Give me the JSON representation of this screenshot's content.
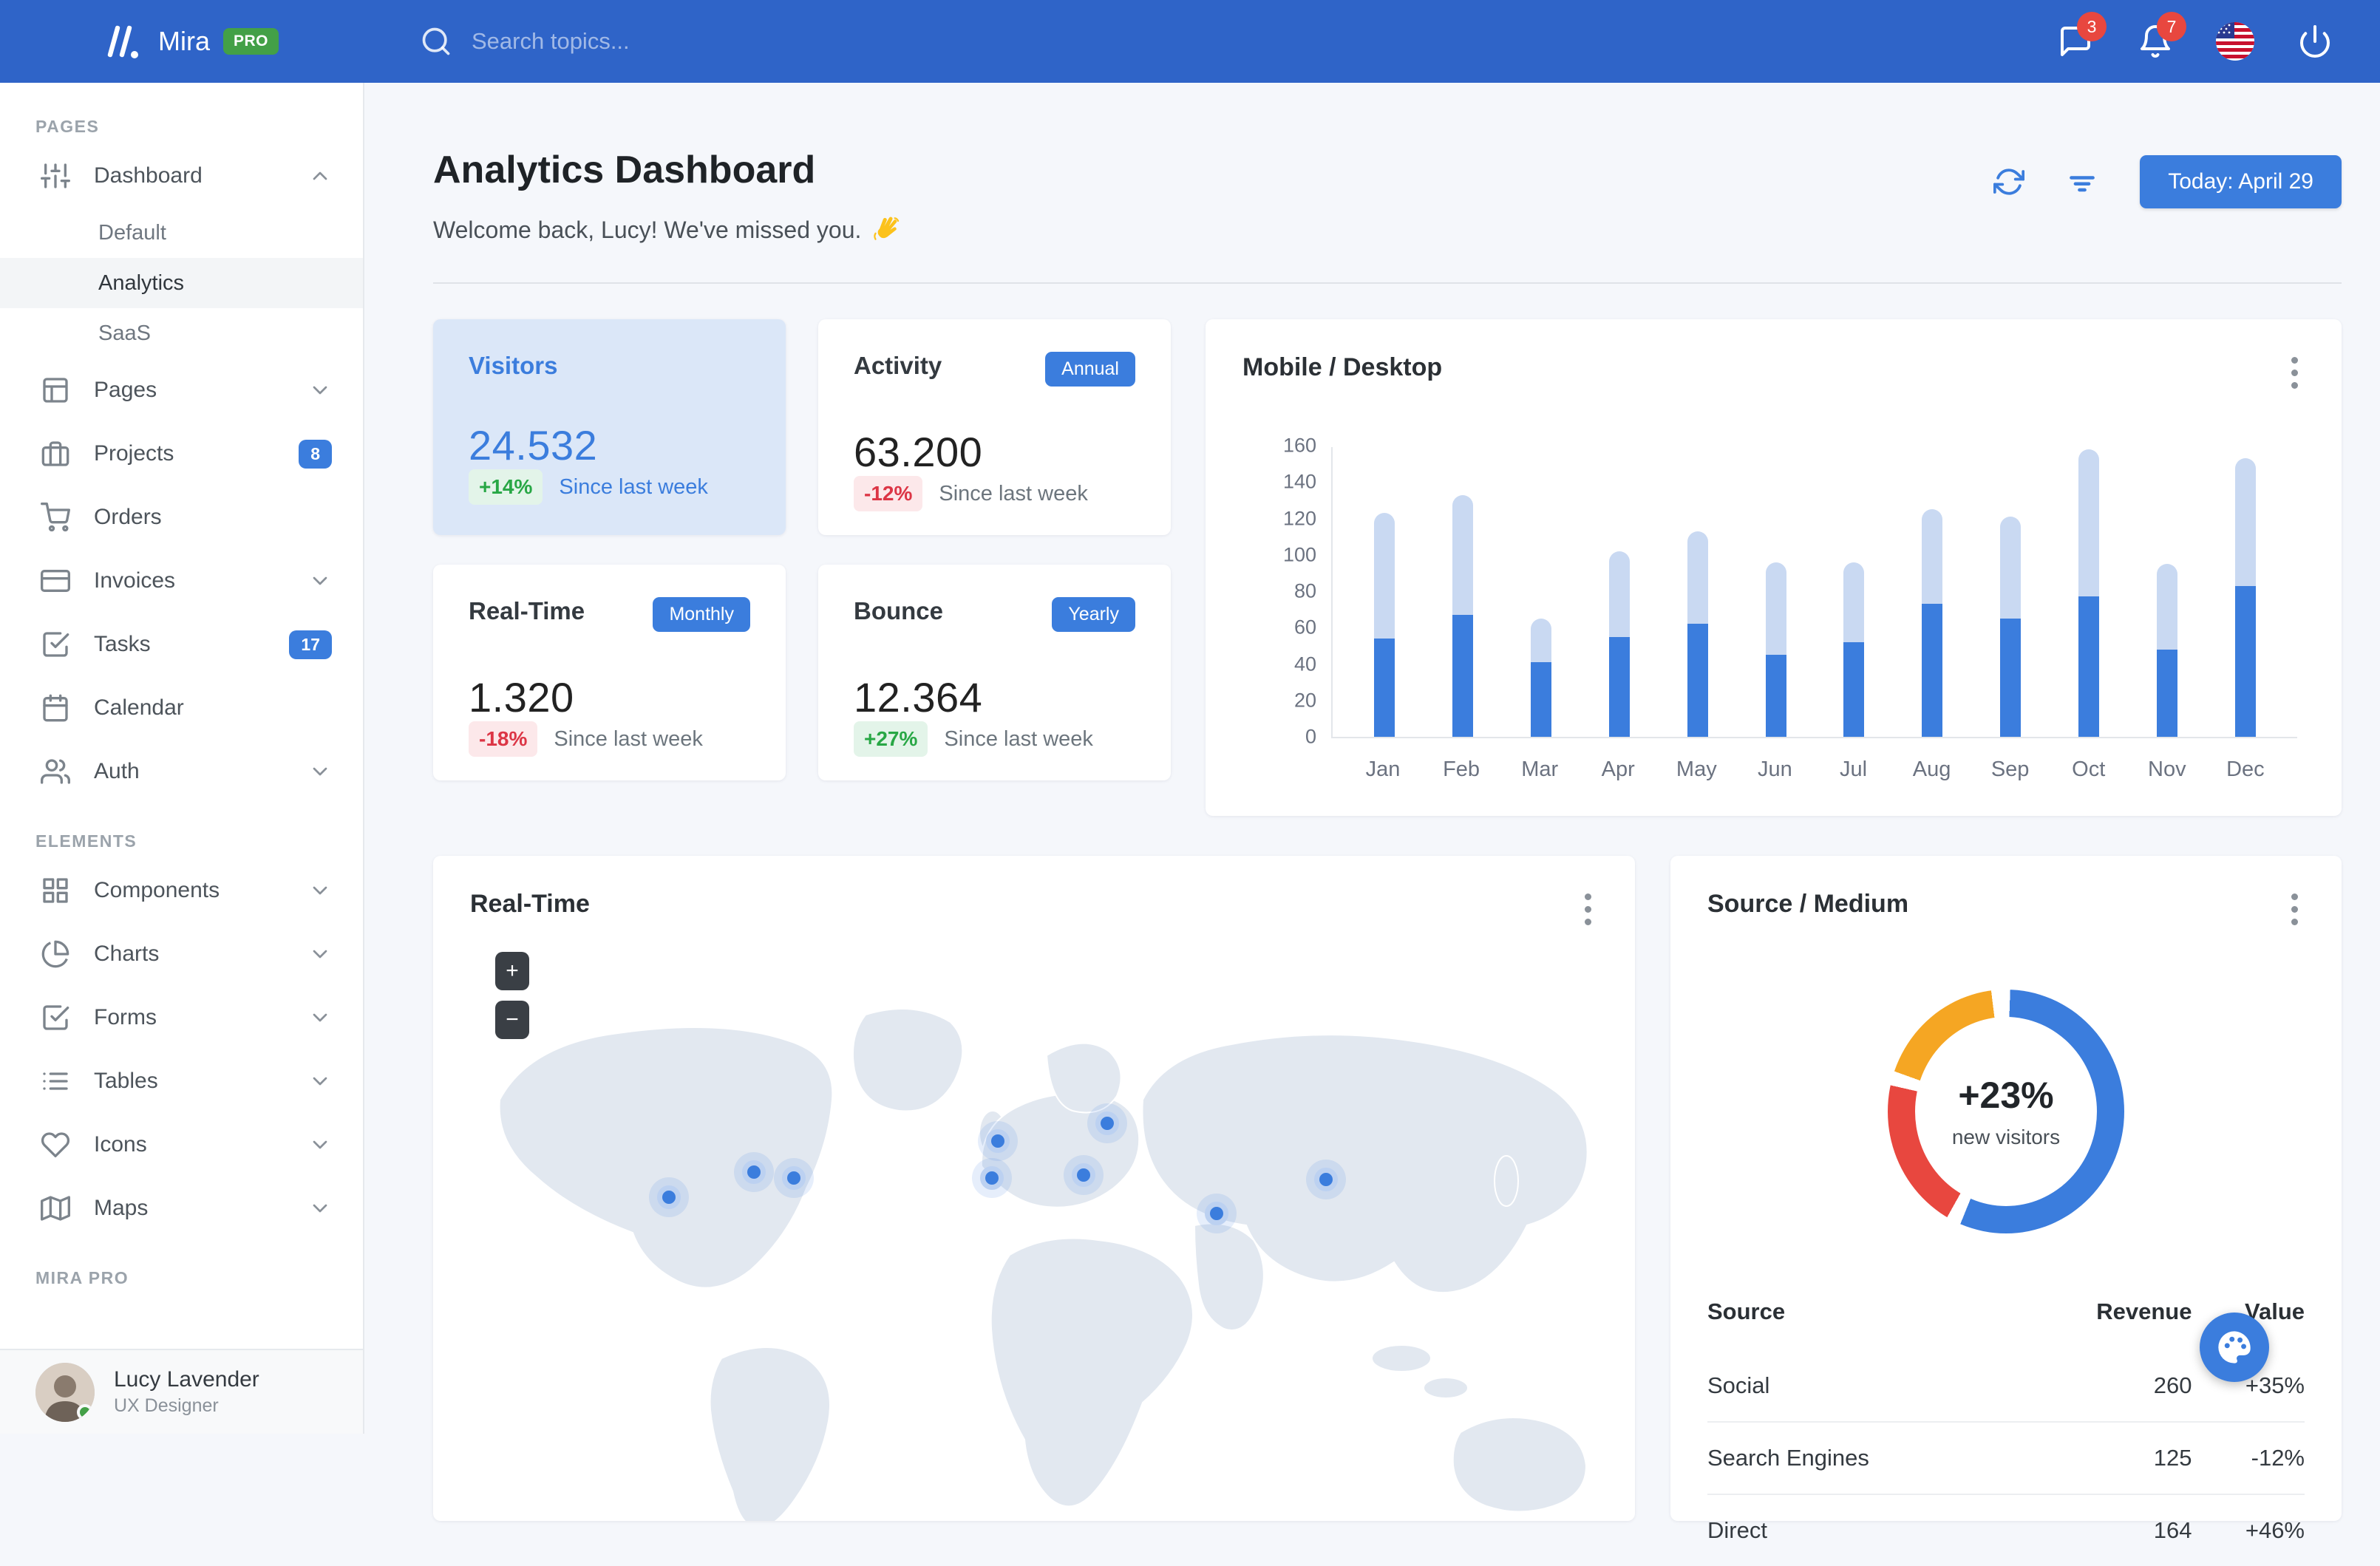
{
  "theme": {
    "accent": "#3B7DDD",
    "navbar_bg": "#2F64C8",
    "positive": "#28A745",
    "negative": "#DC3545",
    "light_bar": "#C9D9F2",
    "donut_red": "#E8473F",
    "donut_orange": "#F5A623",
    "page_bg": "#F5F7FB",
    "highlight_card_bg": "#DBE7F8"
  },
  "navbar": {
    "brand": "Mira",
    "pro_badge": "PRO",
    "search_placeholder": "Search topics...",
    "messages_badge": "3",
    "notifications_badge": "7"
  },
  "sidebar": {
    "sections": [
      {
        "label": "PAGES",
        "items": [
          {
            "label": "Dashboard",
            "icon": "sliders-icon",
            "chevron": "up",
            "children": [
              {
                "label": "Default",
                "active": false
              },
              {
                "label": "Analytics",
                "active": true
              },
              {
                "label": "SaaS",
                "active": false
              }
            ]
          },
          {
            "label": "Pages",
            "icon": "layout-icon",
            "chevron": "down"
          },
          {
            "label": "Projects",
            "icon": "briefcase-icon",
            "badge": "8"
          },
          {
            "label": "Orders",
            "icon": "shopping-cart-icon"
          },
          {
            "label": "Invoices",
            "icon": "credit-card-icon",
            "chevron": "down"
          },
          {
            "label": "Tasks",
            "icon": "check-square-icon",
            "badge": "17"
          },
          {
            "label": "Calendar",
            "icon": "calendar-icon"
          },
          {
            "label": "Auth",
            "icon": "users-icon",
            "chevron": "down"
          }
        ]
      },
      {
        "label": "ELEMENTS",
        "items": [
          {
            "label": "Components",
            "icon": "grid-icon",
            "chevron": "down"
          },
          {
            "label": "Charts",
            "icon": "pie-chart-icon",
            "chevron": "down"
          },
          {
            "label": "Forms",
            "icon": "form-check-icon",
            "chevron": "down"
          },
          {
            "label": "Tables",
            "icon": "list-icon",
            "chevron": "down"
          },
          {
            "label": "Icons",
            "icon": "heart-icon",
            "chevron": "down"
          },
          {
            "label": "Maps",
            "icon": "map-icon",
            "chevron": "down"
          }
        ]
      },
      {
        "label": "MIRA PRO",
        "items": []
      }
    ],
    "user": {
      "name": "Lucy Lavender",
      "role": "UX Designer"
    }
  },
  "header": {
    "title": "Analytics Dashboard",
    "subtitle": "Welcome back, Lucy! We've missed you.",
    "subtitle_emoji": "👋",
    "today_button": "Today: April 29"
  },
  "stats": [
    {
      "title": "Visitors",
      "value": "24.532",
      "badge": "",
      "delta": "+14%",
      "delta_type": "positive",
      "caption": "Since last week",
      "highlight": true
    },
    {
      "title": "Activity",
      "value": "63.200",
      "badge": "Annual",
      "delta": "-12%",
      "delta_type": "negative",
      "caption": "Since last week",
      "highlight": false
    },
    {
      "title": "Real-Time",
      "value": "1.320",
      "badge": "Monthly",
      "delta": "-18%",
      "delta_type": "negative",
      "caption": "Since last week",
      "highlight": false
    },
    {
      "title": "Bounce",
      "value": "12.364",
      "badge": "Yearly",
      "delta": "+27%",
      "delta_type": "positive",
      "caption": "Since last week",
      "highlight": false
    }
  ],
  "chart_data": [
    {
      "type": "bar",
      "stacked": true,
      "title": "Mobile / Desktop",
      "legend": "none",
      "grid": false,
      "categories": [
        "Jan",
        "Feb",
        "Mar",
        "Apr",
        "May",
        "Jun",
        "Jul",
        "Aug",
        "Sep",
        "Oct",
        "Nov",
        "Dec"
      ],
      "series": [
        {
          "name": "Mobile",
          "color": "#3B7DDD",
          "values": [
            54,
            67,
            41,
            55,
            62,
            45,
            52,
            73,
            65,
            77,
            48,
            83
          ]
        },
        {
          "name": "Desktop",
          "color": "#C9D9F2",
          "values": [
            69,
            66,
            24,
            47,
            51,
            51,
            44,
            52,
            56,
            81,
            47,
            70
          ]
        }
      ],
      "ylabel": "",
      "xlabel": "",
      "ylim": [
        0,
        160
      ],
      "yticks": [
        0,
        20,
        40,
        60,
        80,
        100,
        120,
        140,
        160
      ]
    },
    {
      "type": "pie",
      "donut": true,
      "title": "Source / Medium",
      "labels": [
        "segment-blue",
        "segment-red",
        "segment-orange"
      ],
      "values": [
        57,
        21,
        18
      ],
      "colors": [
        "#3B7DDD",
        "#E8473F",
        "#F5A623"
      ],
      "center_value": "+23%",
      "center_label": "new visitors",
      "legend": "none"
    }
  ],
  "realtime_map": {
    "title": "Real-Time",
    "zoom_in": "+",
    "zoom_out": "−",
    "markers": [
      {
        "x": 19.6,
        "y": 43.8
      },
      {
        "x": 26.7,
        "y": 39.5
      },
      {
        "x": 30.0,
        "y": 40.5
      },
      {
        "x": 47.0,
        "y": 34.1
      },
      {
        "x": 46.5,
        "y": 40.5
      },
      {
        "x": 56.1,
        "y": 31.0
      },
      {
        "x": 54.1,
        "y": 40.0
      },
      {
        "x": 65.2,
        "y": 46.7
      },
      {
        "x": 74.3,
        "y": 40.8
      }
    ]
  },
  "source_medium": {
    "title": "Source / Medium",
    "table": {
      "headers": [
        "Source",
        "Revenue",
        "Value"
      ],
      "rows": [
        {
          "source": "Social",
          "revenue": "260",
          "value": "+35%",
          "value_type": "positive"
        },
        {
          "source": "Search Engines",
          "revenue": "125",
          "value": "-12%",
          "value_type": "negative"
        },
        {
          "source": "Direct",
          "revenue": "164",
          "value": "+46%",
          "value_type": "positive"
        }
      ]
    }
  }
}
